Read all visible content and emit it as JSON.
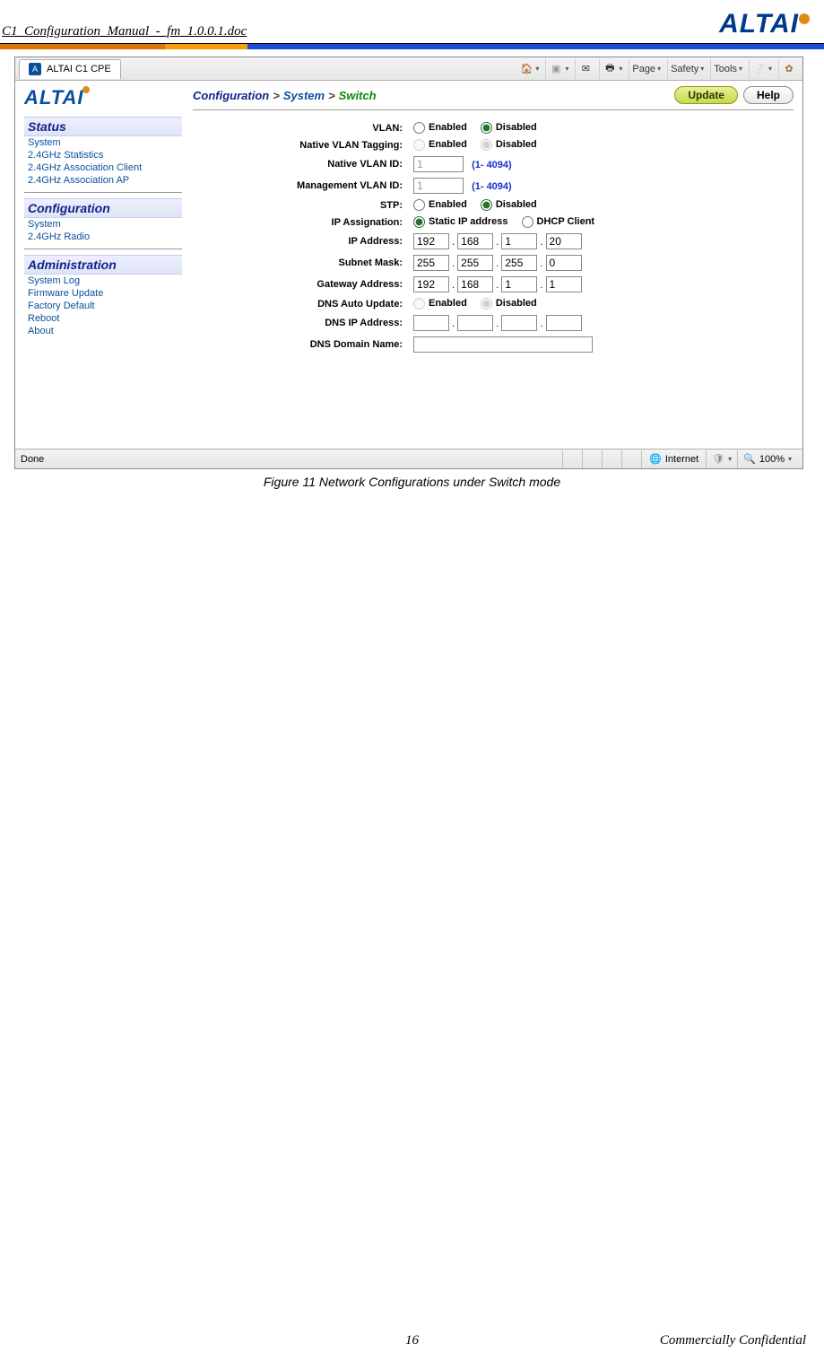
{
  "doc": {
    "filename": "C1_Configuration_Manual_-_fm_1.0.0.1.doc",
    "logo_text": "ALTAI",
    "page_number": "16",
    "confidential": "Commercially Confidential",
    "figure_caption": "Figure 11    Network Configurations under Switch mode"
  },
  "browser": {
    "tab_title": "ALTAI C1 CPE",
    "toolbar": {
      "page": "Page",
      "safety": "Safety",
      "tools": "Tools"
    },
    "status": {
      "done": "Done",
      "zone": "Internet",
      "zoom": "100%"
    }
  },
  "nav": {
    "status": {
      "title": "Status",
      "items": [
        "System",
        "2.4GHz Statistics",
        "2.4GHz Association Client",
        "2.4GHz Association AP"
      ]
    },
    "config": {
      "title": "Configuration",
      "items": [
        "System",
        "2.4GHz Radio"
      ]
    },
    "admin": {
      "title": "Administration",
      "items": [
        "System Log",
        "Firmware Update",
        "Factory Default",
        "Reboot",
        "About"
      ]
    }
  },
  "breadcrumb": {
    "root": "Configuration",
    "mid": "System",
    "leaf": "Switch",
    "sep": ">"
  },
  "buttons": {
    "update": "Update",
    "help": "Help"
  },
  "form": {
    "labels": {
      "vlan": "VLAN:",
      "native_vlan_tagging": "Native VLAN Tagging:",
      "native_vlan_id": "Native VLAN ID:",
      "mgmt_vlan_id": "Management VLAN ID:",
      "stp": "STP:",
      "ip_assignation": "IP Assignation:",
      "ip_address": "IP Address:",
      "subnet_mask": "Subnet Mask:",
      "gateway_address": "Gateway Address:",
      "dns_auto_update": "DNS Auto Update:",
      "dns_ip_address": "DNS IP Address:",
      "dns_domain_name": "DNS Domain Name:"
    },
    "options": {
      "enabled": "Enabled",
      "disabled": "Disabled",
      "static_ip": "Static IP address",
      "dhcp_client": "DHCP Client"
    },
    "values": {
      "vlan": "disabled",
      "native_vlan_tagging": "disabled",
      "native_vlan_id": "1",
      "mgmt_vlan_id": "1",
      "vlan_hint": "(1- 4094)",
      "stp": "disabled",
      "ip_assignation": "static",
      "ip_address": [
        "192",
        "168",
        "1",
        "20"
      ],
      "subnet_mask": [
        "255",
        "255",
        "255",
        "0"
      ],
      "gateway_address": [
        "192",
        "168",
        "1",
        "1"
      ],
      "dns_auto_update": "disabled",
      "dns_ip_address": [
        "",
        "",
        "",
        ""
      ],
      "dns_domain_name": ""
    }
  }
}
